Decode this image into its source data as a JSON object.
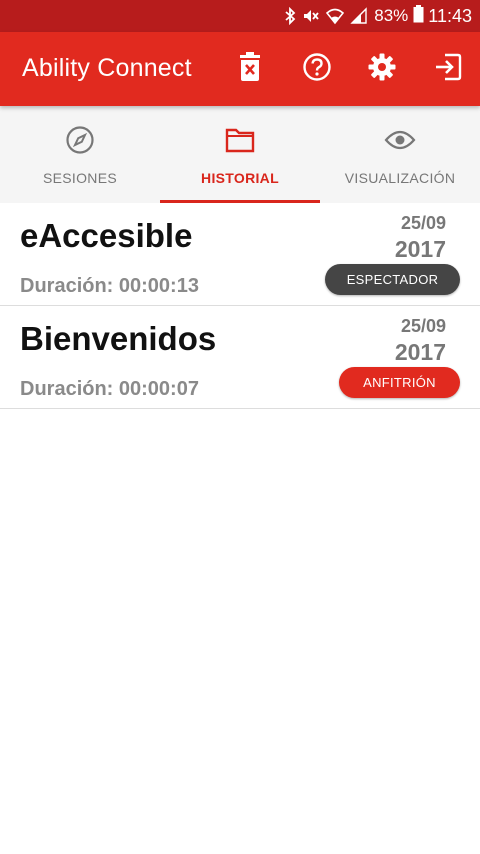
{
  "status_bar": {
    "icons": [
      "bluetooth-icon",
      "mute-icon",
      "wifi-icon",
      "signal-icon"
    ],
    "battery": "83%",
    "time": "11:43"
  },
  "app_bar": {
    "title": "Ability Connect",
    "color": "#e12a1f",
    "actions": [
      "delete-history-icon",
      "help-icon",
      "settings-icon",
      "logout-icon"
    ]
  },
  "tabs": [
    {
      "label": "SESIONES",
      "icon": "compass-icon",
      "active": false
    },
    {
      "label": "HISTORIAL",
      "icon": "folder-icon",
      "active": true
    },
    {
      "label": "VISUALIZACIÓN",
      "icon": "eye-icon",
      "active": false
    }
  ],
  "sessions": [
    {
      "name": "eAccesible",
      "duration": "Duración: 00:00:13",
      "day": "25/09",
      "year": "2017",
      "role": "ESPECTADOR",
      "role_color": "#454545"
    },
    {
      "name": "Bienvenidos",
      "duration": "Duración: 00:00:07",
      "day": "25/09",
      "year": "2017",
      "role": "ANFITRIÓN",
      "role_color": "#e12a1f"
    }
  ]
}
